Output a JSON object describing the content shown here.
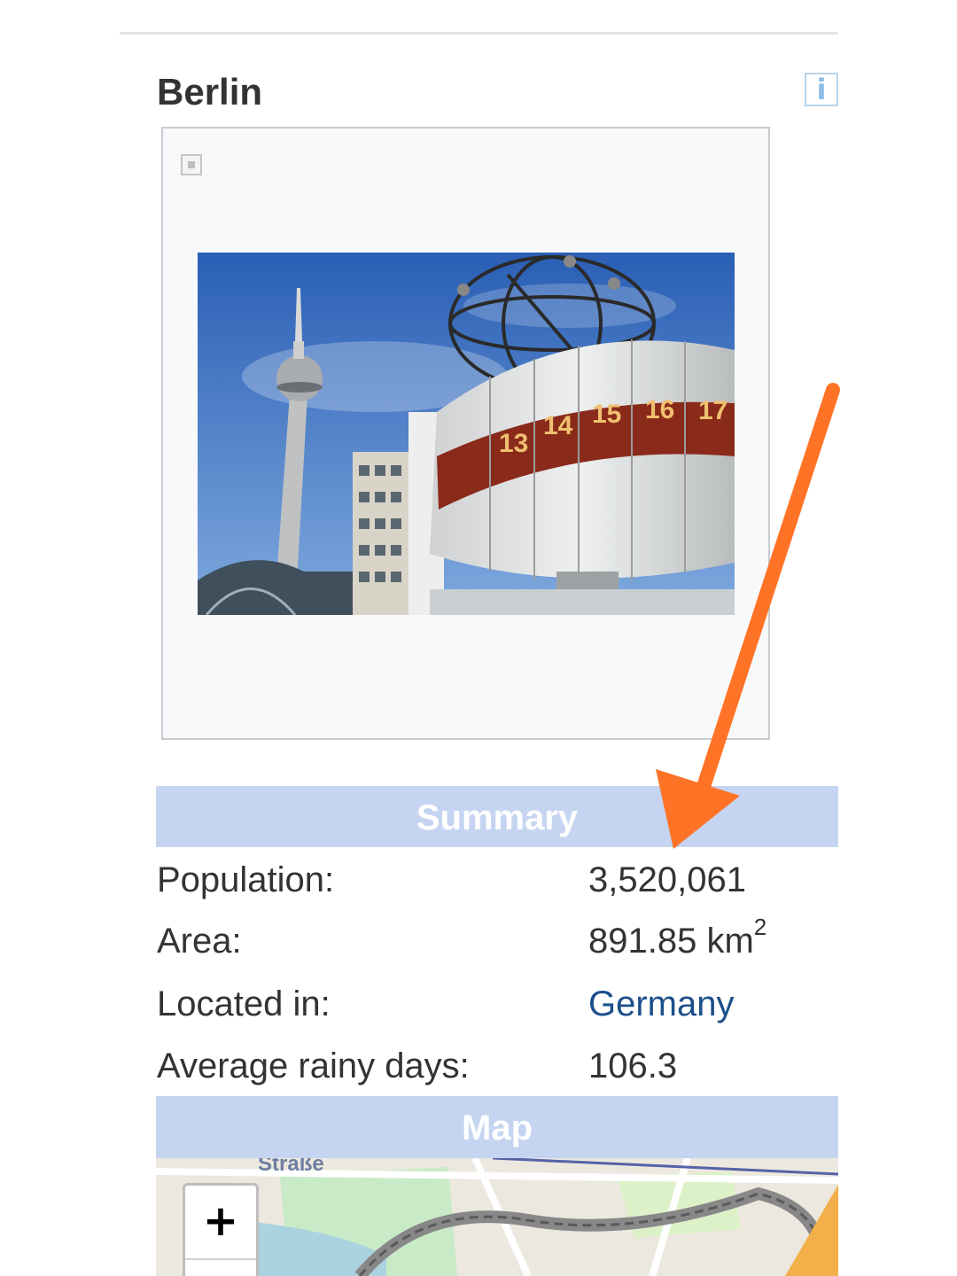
{
  "page": {
    "heading": "Berlin"
  },
  "infobox": {
    "title": "Berlin",
    "info_icon": "info-icon",
    "info_glyph": "i",
    "image_alt": "Berlin Alexanderplatz with TV tower and World Clock",
    "photo_clock_numbers": [
      "13",
      "14",
      "15",
      "16",
      "17"
    ]
  },
  "summary": {
    "header": "Summary",
    "rows": [
      {
        "label": "Population:",
        "value": "3,520,061"
      },
      {
        "label": "Area:",
        "value": "891.85 km",
        "value_sup": "2"
      },
      {
        "label": "Located in:",
        "value": "Germany"
      },
      {
        "label": "Average rainy days:",
        "value": "106.3"
      }
    ]
  },
  "map": {
    "header": "Map",
    "street_label": "Straße",
    "zoom_in": "+"
  },
  "colors": {
    "section_header_bg": "#c5d5f1",
    "link": "#1b4f8a",
    "annotation_arrow": "#ff7327"
  }
}
